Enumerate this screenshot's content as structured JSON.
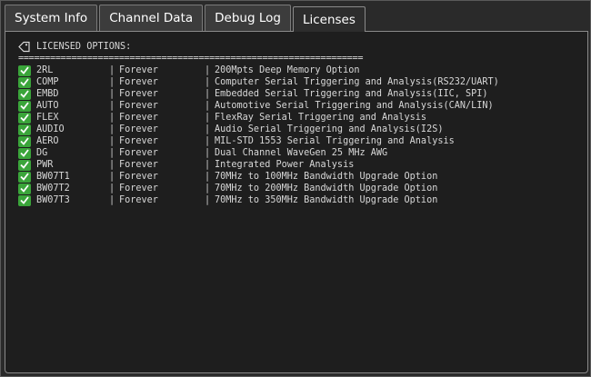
{
  "tabs": [
    {
      "label": "System Info",
      "active": false
    },
    {
      "label": "Channel Data",
      "active": false
    },
    {
      "label": "Debug Log",
      "active": false
    },
    {
      "label": "Licenses",
      "active": true
    }
  ],
  "licenses": {
    "header": "LICENSED OPTIONS:",
    "rule": "=================================================================",
    "separator": "|",
    "status_icon": "check-icon",
    "colors": {
      "check": "#3aa53a",
      "text": "#d8d8d8",
      "background": "#1e1e1e"
    },
    "items": [
      {
        "code": "2RL",
        "term": "Forever",
        "desc": "200Mpts Deep Memory Option"
      },
      {
        "code": "COMP",
        "term": "Forever",
        "desc": "Computer Serial Triggering and Analysis(RS232/UART)"
      },
      {
        "code": "EMBD",
        "term": "Forever",
        "desc": "Embedded Serial Triggering and Analysis(IIC, SPI)"
      },
      {
        "code": "AUTO",
        "term": "Forever",
        "desc": "Automotive Serial Triggering and Analysis(CAN/LIN)"
      },
      {
        "code": "FLEX",
        "term": "Forever",
        "desc": "FlexRay Serial Triggering and Analysis"
      },
      {
        "code": "AUDIO",
        "term": "Forever",
        "desc": "Audio Serial Triggering and Analysis(I2S)"
      },
      {
        "code": "AERO",
        "term": "Forever",
        "desc": "MIL-STD 1553 Serial Triggering and Analysis"
      },
      {
        "code": "DG",
        "term": "Forever",
        "desc": "Dual Channel WaveGen 25 MHz AWG"
      },
      {
        "code": "PWR",
        "term": "Forever",
        "desc": "Integrated Power Analysis"
      },
      {
        "code": "BW07T1",
        "term": "Forever",
        "desc": "70MHz to 100MHz Bandwidth Upgrade Option"
      },
      {
        "code": "BW07T2",
        "term": "Forever",
        "desc": "70MHz to 200MHz Bandwidth Upgrade Option"
      },
      {
        "code": "BW07T3",
        "term": "Forever",
        "desc": "70MHz to 350MHz Bandwidth Upgrade Option"
      }
    ]
  }
}
